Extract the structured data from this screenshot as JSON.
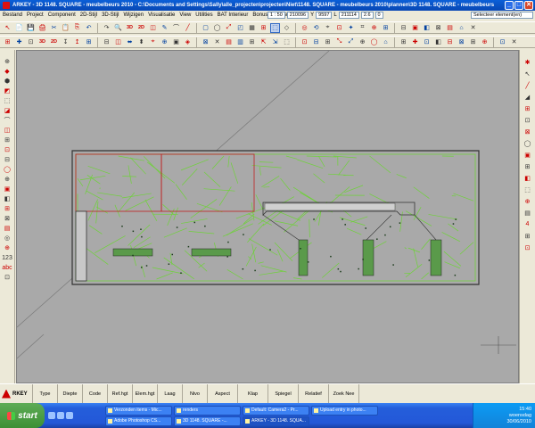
{
  "window": {
    "title": "ARKEY - 3D 1148. SQUARE - meubelbeurs 2010 - C:\\Documents and Settings\\Sally\\alle_projecten\\projecten\\Niet\\1148. SQUARE - meubelbeurs 2010\\plannen\\3D 1148. SQUARE - meubelbeurs"
  },
  "menu": [
    "Bestand",
    "Project",
    "Component",
    "2D-Stijl",
    "3D-Stijl",
    "Wijzigen",
    "Visualisatie",
    "View",
    "Utilities",
    "BAT Interieur",
    "Bonus 3D",
    "Help"
  ],
  "coords": {
    "scale": "1 : 50",
    "x": "210096",
    "y_label": "Y",
    "y": "9597",
    "l_label": "L",
    "l": "211114",
    "z": "2.6",
    "z2": "0"
  },
  "selector": "Selecteer element(en)",
  "toolbar1": [
    "↖",
    "📄",
    "💾",
    "🖨",
    "✂",
    "📋",
    "⎘",
    "↶",
    "↷",
    "🔍",
    "3D",
    "2D",
    "◫",
    "✎",
    "⌒",
    "╱",
    "▢",
    "◯",
    "⤢",
    "◰",
    "▦",
    "⊞",
    "⬚",
    "◇",
    "◎",
    "⟲",
    "⌖",
    "⊡",
    "✦",
    "⌗",
    "⊕",
    "⊞",
    "⊟",
    "▣",
    "◧",
    "⊠",
    "▤",
    "⌂",
    "✕"
  ],
  "toolbar2": [
    "⊞",
    "✚",
    "⊡",
    "3D",
    "2D",
    "↧",
    "↥",
    "⊞",
    "⊟",
    "◫",
    "⬌",
    "⬍",
    "⌖",
    "⊕",
    "▣",
    "◈",
    "⊠",
    "✕",
    "▤",
    "▥",
    "⊞",
    "⇱",
    "⇲",
    "⬚",
    "⊡",
    "⊟",
    "⊞",
    "⤡",
    "⤢",
    "⊕",
    "◯",
    "⌂",
    "⊞",
    "✚",
    "⊡",
    "◧",
    "⊟",
    "⊠",
    "⊞",
    "⊕",
    "⊡",
    "✕"
  ],
  "left_tools": [
    "⊕",
    "◆",
    "⬢",
    "◩",
    "⬚",
    "◪",
    "⌒",
    "◫",
    "⊞",
    "⊡",
    "⊟",
    "◯",
    "⊕",
    "▣",
    "◧",
    "⊞",
    "⊠",
    "▤",
    "◎",
    "⊕",
    "123",
    "abc",
    "⊡"
  ],
  "right_tools": [
    "✱",
    "↖",
    "╱",
    "◢",
    "⊞",
    "⊡",
    "⊠",
    "◯",
    "▣",
    "⊞",
    "◧",
    "⬚",
    "⊕",
    "▤",
    "4",
    "⊞",
    "⊡"
  ],
  "commands": [
    {
      "label": "Type"
    },
    {
      "label": "Diepte"
    },
    {
      "label": "Code"
    },
    {
      "label": "Ref.hgt"
    },
    {
      "label": "Elem.hgt"
    },
    {
      "label": "Laag"
    },
    {
      "label": "Nivo"
    },
    {
      "label": "Aspect"
    },
    {
      "label": "Klap"
    },
    {
      "label": "Spiegel"
    },
    {
      "label": "Relatief"
    },
    {
      "label": "Zoek Nee"
    }
  ],
  "cmd_logo": "RKEY",
  "taskbar": {
    "start": "start",
    "tasks_row1": [
      "Verzonden items - Mic...",
      "renders",
      "Default: Camera2 - Pr...",
      "Upload entry in photo..."
    ],
    "tasks_row2": [
      "Adobe Photoshop CS...",
      "3D 1148. SQUARE -...",
      "ARKEY - 3D 1148. SQUA..."
    ],
    "clock": "15:40",
    "day": "woensdag",
    "date": "30/06/2010"
  },
  "colors": {
    "canvas": "#a9a9a9",
    "plan_green": "#6fd13a",
    "plan_outline": "#333333",
    "plan_red": "#c02020"
  }
}
